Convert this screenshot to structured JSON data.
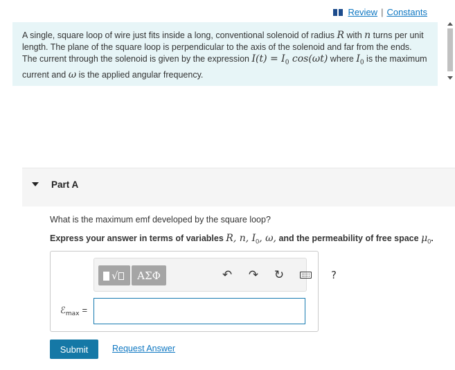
{
  "header": {
    "review_label": "Review",
    "separator": "|",
    "constants_label": "Constants"
  },
  "problem": {
    "s1": "A single, square loop of wire just fits inside a long, conventional solenoid of radius ",
    "v_R": "R",
    "s2": " with ",
    "v_n": "n",
    "s3": " turns per unit length. The plane of the square loop is perpendicular to the axis of the solenoid and far from the ends. The current through the solenoid is given by the expression ",
    "expr_I": "I(t) = I",
    "expr_I_sub": "0",
    "expr_cos": " cos(ωt)",
    "s4": " where ",
    "v_I0": "I",
    "v_I0_sub": "0",
    "s5": " is the maximum current and ",
    "v_w": "ω",
    "s6": " is the applied angular frequency."
  },
  "part": {
    "title": "Part A",
    "question": "What is the maximum emf developed by the square loop?",
    "instr_prefix": "Express your answer in terms of variables ",
    "instr_vars": "R, n, I",
    "instr_vars_sub": "0",
    "instr_w": ", ω,",
    "instr_suffix": " and the permeability of free space ",
    "instr_mu": "μ",
    "instr_mu_sub": "0",
    "instr_end": "."
  },
  "toolbar": {
    "greek_label": "ΑΣΦ",
    "undo_glyph": "↶",
    "redo_glyph": "↷",
    "reset_glyph": "↻",
    "help_label": "?",
    "icons": [
      "template-icon",
      "greek-icon",
      "undo-icon",
      "redo-icon",
      "reset-icon",
      "keyboard-icon",
      "help-icon"
    ]
  },
  "answer": {
    "label_symbol": "ℰ",
    "label_sub": "max",
    "label_eq": "=",
    "value": ""
  },
  "actions": {
    "submit_label": "Submit",
    "request_label": "Request Answer"
  },
  "colors": {
    "link": "#0e77c2",
    "problem_bg": "#e7f5f7",
    "submit_bg": "#1578a6",
    "input_border": "#157ab0",
    "toolbar_button": "#a5a5a5"
  }
}
